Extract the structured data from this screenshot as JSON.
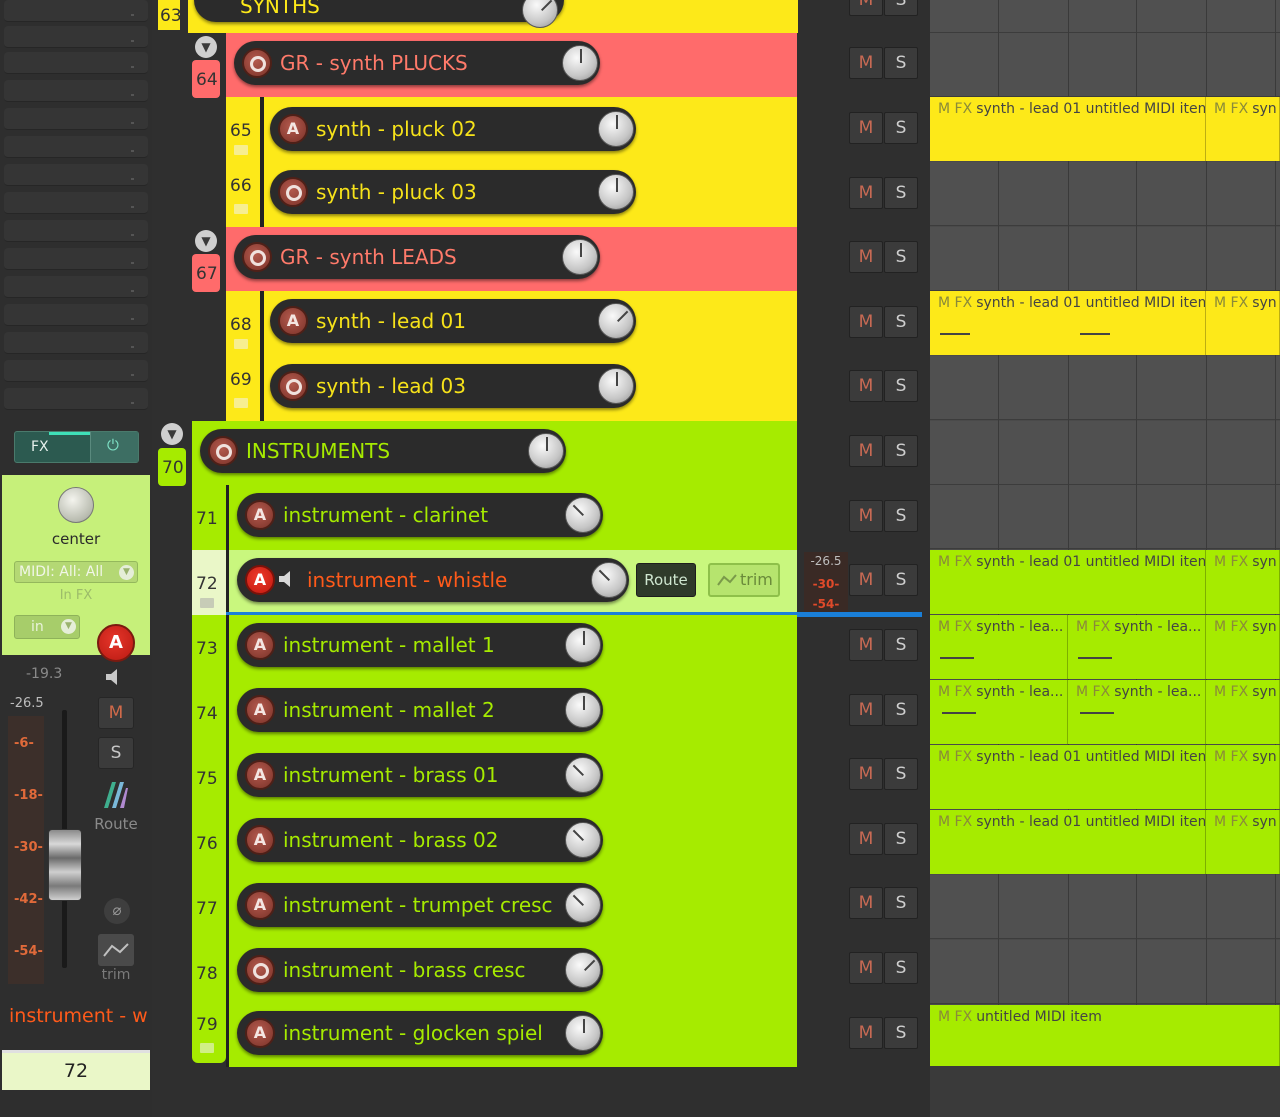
{
  "mixer": {
    "fx_label": "FX",
    "pan_label": "center",
    "midi_input": "MIDI: All: All",
    "in_fx_label": "In FX",
    "input_mode": "in",
    "arm_label": "A",
    "volume_db": "-19.3",
    "peak_db": "-26.5",
    "meter_scale": [
      "-6-",
      "-18-",
      "-30-",
      "-42-",
      "-54-"
    ],
    "mute_label": "M",
    "solo_label": "S",
    "route_label": "Route",
    "phase_symbol": "⌀",
    "trim_label": "trim",
    "channel_name": "instrument - w",
    "channel_number": "72"
  },
  "colors": {
    "red_folder": "#ff6b6b",
    "yellow_track": "#fde919",
    "green_track": "#a6eb00",
    "selected_track": "#c9f77e",
    "arrange_bg": "#4a4a4a",
    "selection_line": "#1a7fd8"
  },
  "tracks": [
    {
      "num": "63",
      "name": "SYNTHS"
    },
    {
      "num": "64",
      "name": "GR - synth PLUCKS",
      "arm": "O"
    },
    {
      "num": "65",
      "name": "synth - pluck 02",
      "arm": "A"
    },
    {
      "num": "66",
      "name": "synth - pluck 03",
      "arm": "O"
    },
    {
      "num": "67",
      "name": "GR - synth LEADS",
      "arm": "O"
    },
    {
      "num": "68",
      "name": "synth - lead 01",
      "arm": "A"
    },
    {
      "num": "69",
      "name": "synth - lead 03",
      "arm": "O"
    },
    {
      "num": "70",
      "name": "INSTRUMENTS",
      "arm": "O"
    },
    {
      "num": "71",
      "name": "instrument - clarinet",
      "arm": "A"
    },
    {
      "num": "72",
      "name": "instrument - whistle",
      "arm": "A"
    },
    {
      "num": "73",
      "name": "instrument - mallet 1",
      "arm": "A"
    },
    {
      "num": "74",
      "name": "instrument - mallet 2",
      "arm": "A"
    },
    {
      "num": "75",
      "name": "instrument - brass 01",
      "arm": "A"
    },
    {
      "num": "76",
      "name": "instrument - brass 02",
      "arm": "A"
    },
    {
      "num": "77",
      "name": "instrument - trumpet cresc",
      "arm": "A"
    },
    {
      "num": "78",
      "name": "instrument - brass cresc",
      "arm": "O"
    },
    {
      "num": "79",
      "name": "instrument - glocken spiel",
      "arm": "A"
    }
  ],
  "track_buttons": {
    "mute": "M",
    "solo": "S",
    "route": "Route",
    "trim": "trim"
  },
  "track_meter": {
    "peak": "-26.5",
    "scale": [
      "-30-",
      "-54-"
    ]
  },
  "items": {
    "mfx": "M FX",
    "full": "synth - lead 01 untitled MIDI item",
    "short": "synth - lea...",
    "cut": "syn",
    "untitled": "untitled MIDI item"
  }
}
